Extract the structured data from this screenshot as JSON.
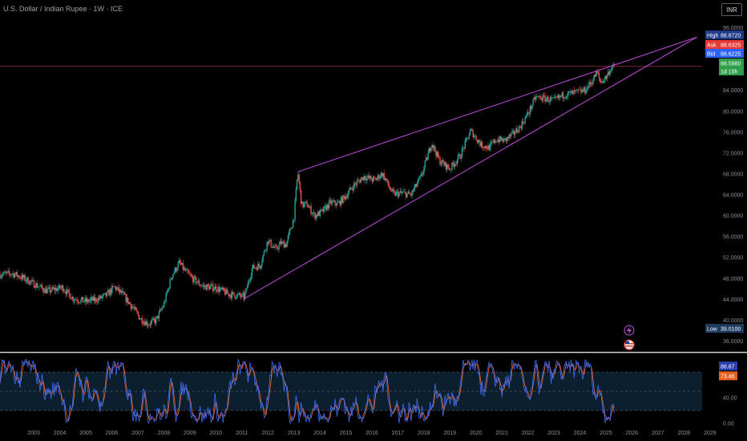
{
  "title": "U.S. Dollar / Indian Rupee · 1W · ICE",
  "currency_button": "INR",
  "price_tags": {
    "high_label": "High",
    "high_value": "88.8720",
    "ask_label": "Ask",
    "ask_value": "88.6325",
    "bid_label": "Bid",
    "bid_value": "88.6225",
    "last_value": "88.5980",
    "countdown": "1d 15h",
    "low_label": "Low",
    "low_value": "39.0100"
  },
  "oscillator_tags": {
    "k": "88.87",
    "d": "73.46"
  },
  "colors": {
    "background": "#000000",
    "up": "#26a69a",
    "down": "#ef5350",
    "trendline": "#b94fd6",
    "hline": "#a0305a",
    "k_line": "#3a6fff",
    "d_line": "#ff6d2a",
    "high_tag": "#1e3a8a",
    "ask_tag": "#e53935",
    "bid_tag": "#2962ff",
    "last_tag": "#2e9e4a",
    "low_tag": "#1e3a5f"
  },
  "icons": [
    "lightning-icon",
    "us-flag-icon"
  ],
  "chart_data": [
    {
      "type": "candlestick",
      "title": "U.S. Dollar / Indian Rupee · 1W · ICE",
      "x_ticks": [
        "2003",
        "2004",
        "2005",
        "2006",
        "2007",
        "2008",
        "2009",
        "2010",
        "2011",
        "2012",
        "2013",
        "2014",
        "2015",
        "2016",
        "2017",
        "2018",
        "2019",
        "2020",
        "2021",
        "2022",
        "2023",
        "2024",
        "2025",
        "2026",
        "2027",
        "2028",
        "2029"
      ],
      "y_ticks": [
        "36.0000",
        "40.0000",
        "44.0000",
        "48.0000",
        "52.0000",
        "56.0000",
        "60.0000",
        "64.0000",
        "68.0000",
        "72.0000",
        "76.0000",
        "80.0000",
        "84.0000",
        "88.0000",
        "92.0000",
        "96.0000"
      ],
      "ylim": [
        35,
        97
      ],
      "xlim": [
        2002.2,
        2029.2
      ],
      "price_path": [
        [
          2002.2,
          48.8
        ],
        [
          2002.7,
          48.9
        ],
        [
          2003.0,
          48.3
        ],
        [
          2003.5,
          47.0
        ],
        [
          2004.0,
          45.6
        ],
        [
          2004.3,
          45.9
        ],
        [
          2004.6,
          46.3
        ],
        [
          2005.0,
          44.2
        ],
        [
          2005.5,
          43.6
        ],
        [
          2006.0,
          44.1
        ],
        [
          2006.3,
          44.8
        ],
        [
          2006.6,
          46.4
        ],
        [
          2006.9,
          45.0
        ],
        [
          2007.3,
          42.5
        ],
        [
          2007.6,
          40.3
        ],
        [
          2007.9,
          39.3
        ],
        [
          2008.2,
          40.0
        ],
        [
          2008.5,
          43.0
        ],
        [
          2008.8,
          48.5
        ],
        [
          2009.1,
          51.0
        ],
        [
          2009.3,
          49.5
        ],
        [
          2009.6,
          48.0
        ],
        [
          2010.0,
          46.5
        ],
        [
          2010.5,
          46.2
        ],
        [
          2011.0,
          45.0
        ],
        [
          2011.6,
          44.5
        ],
        [
          2011.9,
          50.0
        ],
        [
          2012.2,
          50.5
        ],
        [
          2012.5,
          55.3
        ],
        [
          2012.8,
          53.5
        ],
        [
          2013.0,
          54.8
        ],
        [
          2013.2,
          54.5
        ],
        [
          2013.5,
          59.5
        ],
        [
          2013.65,
          68.4
        ],
        [
          2013.8,
          62.0
        ],
        [
          2014.0,
          62.2
        ],
        [
          2014.3,
          60.0
        ],
        [
          2014.6,
          60.8
        ],
        [
          2014.9,
          62.5
        ],
        [
          2015.2,
          62.3
        ],
        [
          2015.5,
          63.8
        ],
        [
          2015.8,
          65.8
        ],
        [
          2016.2,
          67.5
        ],
        [
          2016.6,
          66.8
        ],
        [
          2016.9,
          68.1
        ],
        [
          2017.3,
          64.2
        ],
        [
          2017.7,
          64.3
        ],
        [
          2018.0,
          64.0
        ],
        [
          2018.4,
          67.5
        ],
        [
          2018.8,
          74.0
        ],
        [
          2019.1,
          70.5
        ],
        [
          2019.5,
          69.0
        ],
        [
          2019.9,
          71.5
        ],
        [
          2020.3,
          76.3
        ],
        [
          2020.7,
          73.6
        ],
        [
          2021.0,
          73.0
        ],
        [
          2021.3,
          74.6
        ],
        [
          2021.6,
          74.4
        ],
        [
          2021.9,
          75.5
        ],
        [
          2022.2,
          77.0
        ],
        [
          2022.5,
          79.5
        ],
        [
          2022.8,
          82.7
        ],
        [
          2023.1,
          82.5
        ],
        [
          2023.5,
          82.0
        ],
        [
          2023.9,
          83.2
        ],
        [
          2024.3,
          83.5
        ],
        [
          2024.7,
          84.0
        ],
        [
          2025.0,
          86.0
        ],
        [
          2025.15,
          87.5
        ],
        [
          2025.3,
          85.5
        ],
        [
          2025.5,
          86.5
        ],
        [
          2025.7,
          88.3
        ],
        [
          2025.85,
          88.6
        ]
      ],
      "high": 88.872,
      "low": 39.01,
      "last": 88.598,
      "hline": 88.6,
      "trendlines": [
        {
          "name": "upper",
          "from": [
            2013.65,
            68.4
          ],
          "to": [
            2029.0,
            94.2
          ]
        },
        {
          "name": "lower",
          "from": [
            2011.55,
            44.0
          ],
          "to": [
            2029.0,
            94.2
          ]
        }
      ]
    },
    {
      "type": "line",
      "name": "stochastic-rsi",
      "ylim": [
        0,
        100
      ],
      "y_ticks": [
        "0.00",
        "40.00"
      ],
      "levels": [
        20,
        80
      ],
      "series": [
        {
          "values_last": 88.87
        },
        {
          "values_last": 73.46
        }
      ]
    }
  ]
}
